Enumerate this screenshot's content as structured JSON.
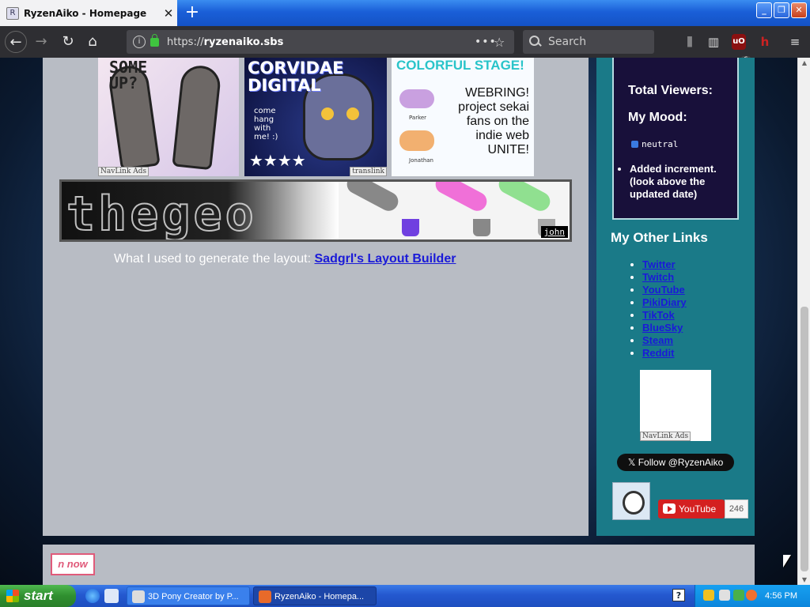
{
  "browser": {
    "tab_title": "RyzenAiko - Homepage",
    "tab_close": "✕",
    "new_tab": "+",
    "url": "https://ryzenaiko.sbs",
    "url_host": "ryzenaiko.sbs",
    "url_scheme": "https://",
    "page_actions": "•••",
    "bookmark": "☆",
    "search_placeholder": "Search",
    "ublock_count": "6",
    "window": {
      "minimize": "_",
      "restore": "❐",
      "close": "✕"
    }
  },
  "page": {
    "badges": [
      {
        "text": "SOME\nUP?",
        "caption": "NavLink Ads"
      },
      {
        "text": "CORVIDAE\nDIGITAL",
        "small": "come\nhang\nwith\nme! :)",
        "caption": "translink"
      },
      {
        "head": "COLORFUL STAGE!",
        "body": "WEBRING!\nproject sekai\nfans on the\nindie web\nUNITE!",
        "name1": "Parker",
        "name2": "Jonathan"
      }
    ],
    "banner": {
      "glitch_text": "thegeo",
      "signature": "john"
    },
    "credit_prefix": "What I used to generate the layout:",
    "credit_link": "Sadgrl's Layout Builder",
    "footer_button": "n now"
  },
  "sidebar": {
    "total_viewers_label": "Total Viewers:",
    "mood_label": "My Mood:",
    "mood_value": "neutral",
    "update_item": "Added increment. (look above the updated date)",
    "other_links_heading": "My Other Links",
    "links": [
      "Twitter",
      "Twitch",
      "YouTube",
      "PikiDiary",
      "TikTok",
      "BlueSky",
      "Steam",
      "Reddit"
    ],
    "navlink_caption": "NavLink Ads",
    "x_follow": "𝕏 Follow @RyzenAiko",
    "youtube_label": "YouTube",
    "youtube_count": "246"
  },
  "taskbar": {
    "start": "start",
    "tasks": [
      "3D Pony Creator by P...",
      "RyzenAiko - Homepa..."
    ],
    "help": "?",
    "clock": "4:56 PM"
  }
}
